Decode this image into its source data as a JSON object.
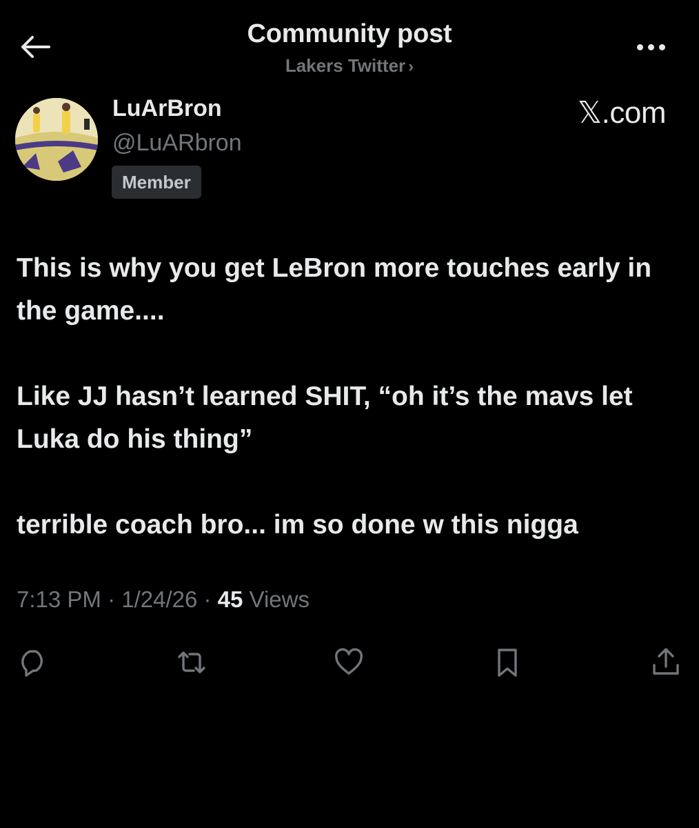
{
  "header": {
    "title": "Community post",
    "community_name": "Lakers Twitter",
    "community_chevron": "›",
    "back_icon": "arrow-left-icon",
    "more_icon": "more-horizontal-icon"
  },
  "author": {
    "name": "LuArBron",
    "handle": "@LuARbron",
    "badge": "Member",
    "avatar_icon": "avatar-image"
  },
  "source": {
    "label": "𝕏.com"
  },
  "post": {
    "paragraphs": [
      "This is why you get LeBron more touches early in the game....",
      "Like JJ hasn’t learned SHIT, “oh it’s the mavs let Luka do his thing”",
      "terrible coach bro... im so done w this nigga"
    ]
  },
  "meta": {
    "time": "7:13 PM",
    "separator": " · ",
    "date": "1/24/26",
    "views_count": "45",
    "views_label": " Views"
  },
  "actions": {
    "reply_icon": "reply-icon",
    "repost_icon": "repost-icon",
    "like_icon": "like-icon",
    "bookmark_icon": "bookmark-icon",
    "share_icon": "share-icon"
  },
  "colors": {
    "background": "#000000",
    "primary_text": "#e7e9ea",
    "secondary_text": "#71767b",
    "badge_bg": "#2a2d31"
  }
}
